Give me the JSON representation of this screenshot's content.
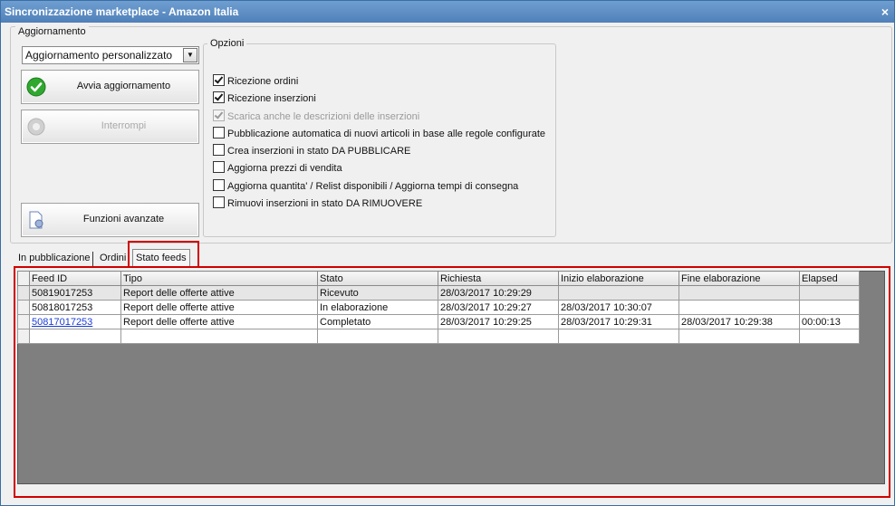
{
  "window": {
    "title": "Sincronizzazione marketplace - Amazon Italia",
    "close_glyph": "×"
  },
  "aggiornamento": {
    "label": "Aggiornamento",
    "select_value": "Aggiornamento personalizzato",
    "avvia_label": "Avvia aggiornamento",
    "interrompi_label": "Interrompi",
    "funzioni_label": "Funzioni avanzate"
  },
  "opzioni": {
    "label": "Opzioni",
    "items": [
      {
        "label": "Ricezione ordini",
        "checked": true,
        "enabled": true
      },
      {
        "label": "Ricezione inserzioni",
        "checked": true,
        "enabled": true
      },
      {
        "label": "Scarica anche le descrizioni delle inserzioni",
        "checked": true,
        "enabled": false
      },
      {
        "label": "Pubblicazione automatica di nuovi articoli in base alle regole configurate",
        "checked": false,
        "enabled": true
      },
      {
        "label": "Crea inserzioni in stato DA PUBBLICARE",
        "checked": false,
        "enabled": true
      },
      {
        "label": "Aggiorna prezzi di vendita",
        "checked": false,
        "enabled": true
      },
      {
        "label": "Aggiorna quantita' / Relist disponibili / Aggiorna tempi di consegna",
        "checked": false,
        "enabled": true
      },
      {
        "label": "Rimuovi inserzioni in stato DA RIMUOVERE",
        "checked": false,
        "enabled": true
      }
    ]
  },
  "tabs": [
    "In pubblicazione",
    "Ordini",
    "Stato feeds"
  ],
  "active_tab": "Stato feeds",
  "grid": {
    "columns": [
      "Feed ID",
      "Tipo",
      "Stato",
      "Richiesta",
      "Inizio elaborazione",
      "Fine elaborazione",
      "Elapsed"
    ],
    "rows": [
      [
        "50819017253",
        "Report delle offerte attive",
        "Ricevuto",
        "28/03/2017 10:29:29",
        "",
        "",
        ""
      ],
      [
        "50818017253",
        "Report delle offerte attive",
        "In elaborazione",
        "28/03/2017 10:29:27",
        "28/03/2017 10:30:07",
        "",
        ""
      ],
      [
        "50817017253",
        "Report delle offerte attive",
        "Completato",
        "28/03/2017 10:29:25",
        "28/03/2017 10:29:31",
        "28/03/2017 10:29:38",
        "00:00:13"
      ],
      [
        "",
        "",
        "",
        "",
        "",
        "",
        ""
      ]
    ]
  },
  "colors": {
    "title_bar": "#4f80b8",
    "highlight": "#d00000",
    "link": "#1a3cd6",
    "grid_background": "#7f7f7f"
  }
}
